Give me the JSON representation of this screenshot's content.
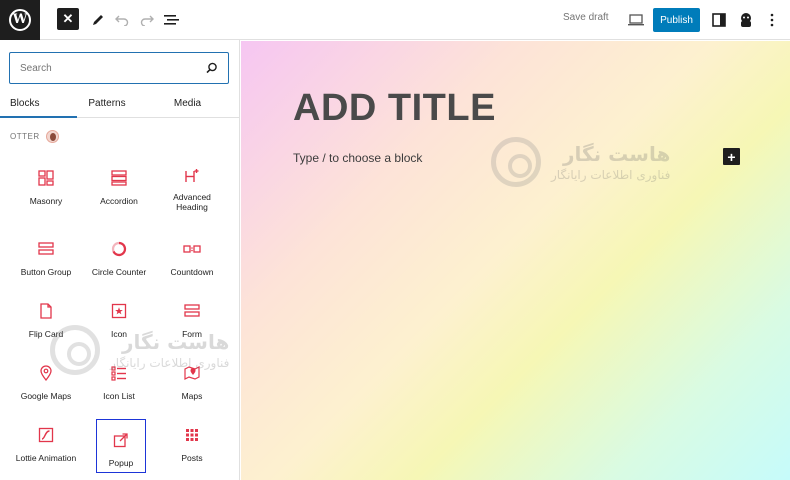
{
  "toolbar": {
    "save_draft": "Save draft",
    "publish": "Publish",
    "close_glyph": "✕"
  },
  "sidebar": {
    "search_placeholder": "Search",
    "tabs": [
      {
        "label": "Blocks",
        "active": true
      },
      {
        "label": "Patterns",
        "active": false
      },
      {
        "label": "Media",
        "active": false
      }
    ],
    "category": "OTTER",
    "blocks": [
      {
        "label": "Masonry",
        "icon": "masonry-icon"
      },
      {
        "label": "Accordion",
        "icon": "accordion-icon"
      },
      {
        "label": "Advanced Heading",
        "icon": "advanced-heading-icon"
      },
      {
        "label": "Button Group",
        "icon": "button-group-icon"
      },
      {
        "label": "Circle Counter",
        "icon": "circle-counter-icon"
      },
      {
        "label": "Countdown",
        "icon": "countdown-icon"
      },
      {
        "label": "Flip Card",
        "icon": "flip-card-icon"
      },
      {
        "label": "Icon",
        "icon": "icon-block-icon"
      },
      {
        "label": "Form",
        "icon": "form-icon"
      },
      {
        "label": "Google Maps",
        "icon": "google-maps-icon"
      },
      {
        "label": "Icon List",
        "icon": "icon-list-icon"
      },
      {
        "label": "Maps",
        "icon": "maps-icon"
      },
      {
        "label": "Lottie Animation",
        "icon": "lottie-animation-icon"
      },
      {
        "label": "Popup",
        "icon": "popup-icon",
        "highlighted": true
      },
      {
        "label": "Posts",
        "icon": "posts-icon"
      }
    ]
  },
  "editor": {
    "title": "ADD TITLE",
    "placeholder": "Type / to choose a block",
    "add_glyph": "+"
  },
  "watermark": {
    "line1": "هاست نگار",
    "line2": "فناوری اطلاعات رایانگار"
  },
  "colors": {
    "accent": "#007cba",
    "icon_red": "#e2364b",
    "highlight": "#1d35d8"
  }
}
